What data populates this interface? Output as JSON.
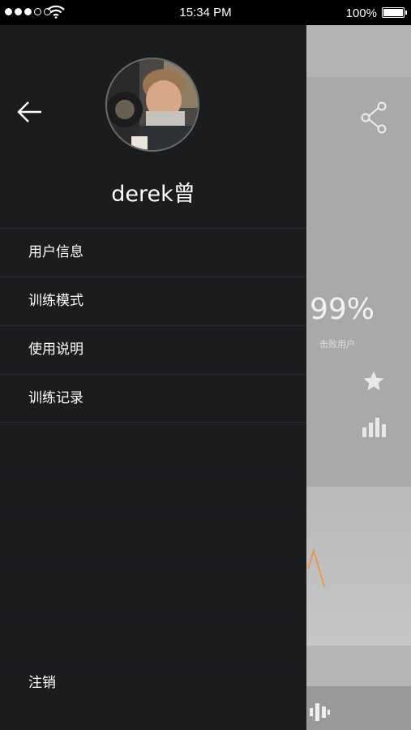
{
  "status_bar": {
    "time": "15:34 PM",
    "battery": "100%"
  },
  "drawer": {
    "username": "derek曾",
    "menu": [
      {
        "label": "用户信息"
      },
      {
        "label": "训练模式"
      },
      {
        "label": "使用说明"
      },
      {
        "label": "训练记录"
      }
    ],
    "logout_label": "注销"
  },
  "background": {
    "percent": "99%",
    "percent_label": "击败用户"
  },
  "icons": {
    "back": "back-arrow-icon",
    "share": "share-icon",
    "star": "star-icon",
    "stats": "bar-chart-icon"
  },
  "colors": {
    "drawer_bg": "#1b1c1e",
    "text": "#ffffff"
  }
}
